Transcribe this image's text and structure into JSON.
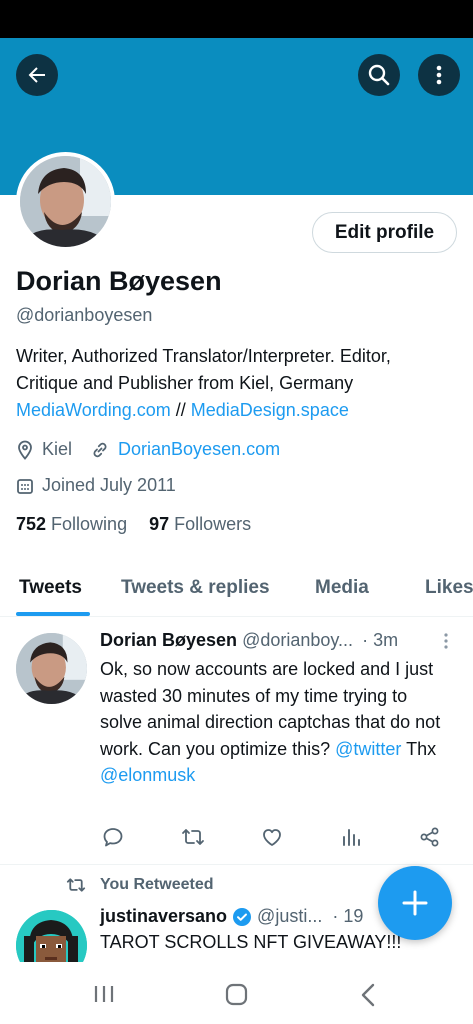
{
  "profile": {
    "name": "Dorian Bøyesen",
    "handle": "@dorianboyesen",
    "bio_line1": "Writer, Authorized Translator/Interpreter.  Editor,",
    "bio_line2": "Critique and Publisher from Kiel, Germany",
    "bio_link1": "MediaWording.com",
    "bio_sep": " // ",
    "bio_link2": "MediaDesign.space",
    "location": "Kiel",
    "website": "DorianBoyesen.com",
    "joined": "Joined July 2011",
    "following_count": "752",
    "following_label": "Following",
    "followers_count": "97",
    "followers_label": "Followers",
    "edit_label": "Edit profile"
  },
  "tabs": [
    "Tweets",
    "Tweets & replies",
    "Media",
    "Likes"
  ],
  "tweet": {
    "name": "Dorian Bøyesen",
    "handle": "@dorianboy...",
    "time": "· 3m",
    "text_before": "Ok, so now accounts are locked and I just wasted 30 minutes of my time trying to solve animal direction captchas that do not work. Can you optimize this?",
    "mention1": "@twitter",
    "text_mid": " Thx",
    "mention2": "@elonmusk"
  },
  "retweet": {
    "label": "You Retweeted",
    "name": "justinaversano",
    "handle": "@justi...",
    "time": "· 19",
    "text": "TAROT SCROLLS NFT GIVEAWAY!!!"
  },
  "colors": {
    "banner": "#0a8dbf",
    "accent": "#1d9bf0",
    "muted": "#536471"
  },
  "icons": [
    "back-arrow-icon",
    "search-icon",
    "more-vertical-icon",
    "location-pin-icon",
    "link-icon",
    "calendar-icon",
    "reply-icon",
    "retweet-icon",
    "like-icon",
    "views-icon",
    "share-icon",
    "plus-icon"
  ]
}
